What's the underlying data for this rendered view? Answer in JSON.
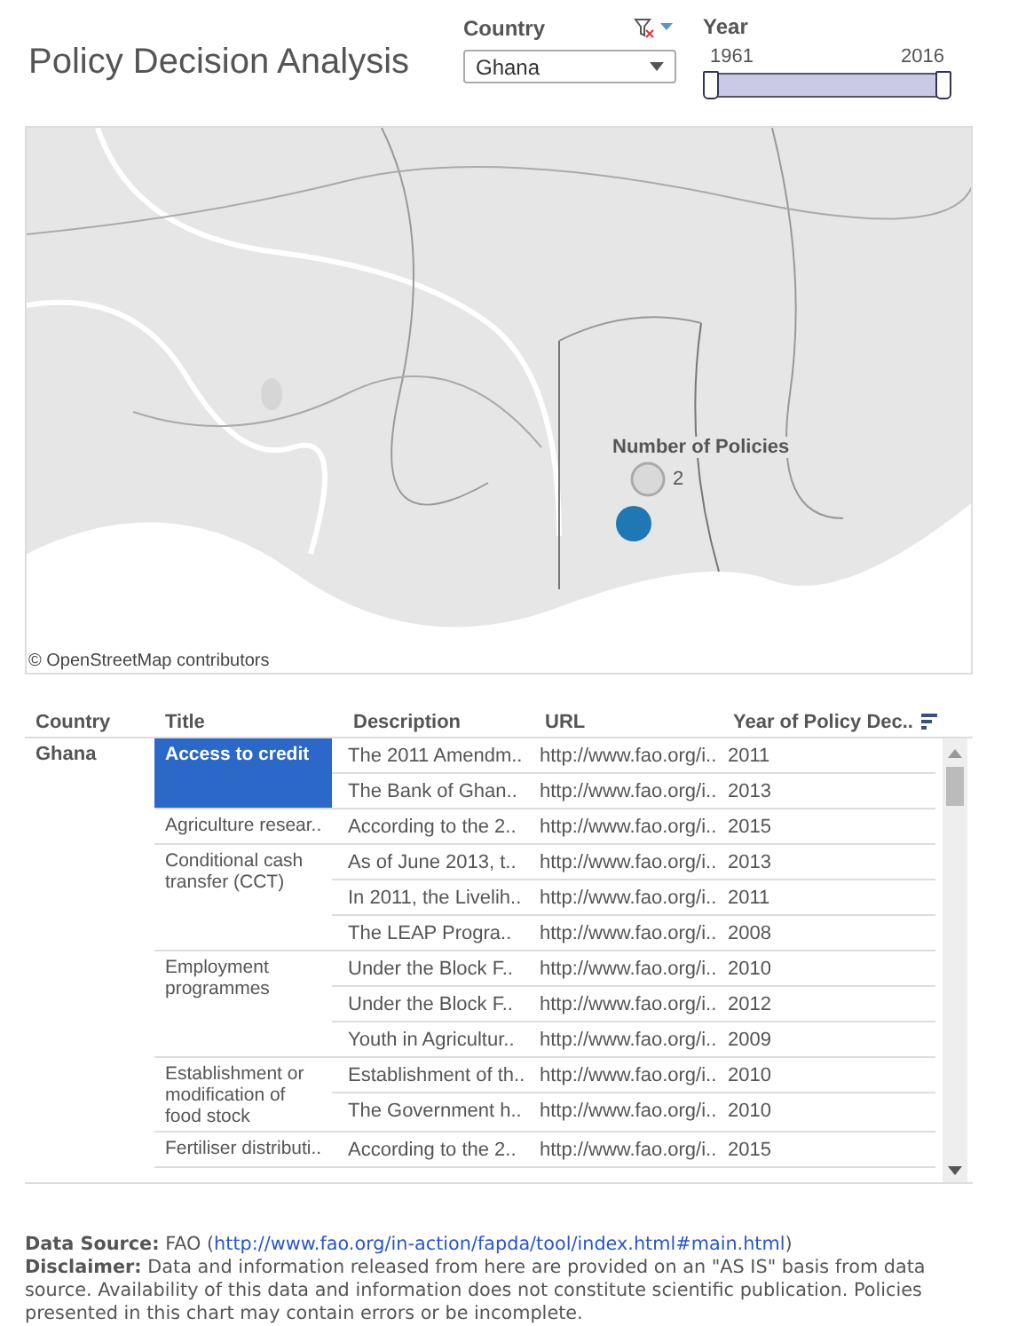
{
  "title": "Policy Decision Analysis",
  "country_filter": {
    "label": "Country",
    "value": "Ghana"
  },
  "year_filter": {
    "label": "Year",
    "start": "1961",
    "end": "2016",
    "level": 1
  },
  "map": {
    "legend_title": "Number of Policies",
    "legend_value": "2",
    "attribution": "© OpenStreetMap contributors"
  },
  "table": {
    "columns": [
      "Country",
      "Title",
      "Description",
      "URL",
      "Year of Policy Dec.."
    ],
    "country": "Ghana",
    "groups": [
      {
        "title": "Access to credit",
        "selected": true,
        "rows": [
          {
            "description": "The 2011 Amendm..",
            "url": "http://www.fao.org/i..",
            "year": "2011"
          },
          {
            "description": "The Bank of Ghan..",
            "url": "http://www.fao.org/i..",
            "year": "2013"
          }
        ]
      },
      {
        "title": "Agriculture resear..",
        "selected": false,
        "rows": [
          {
            "description": "According to the 2..",
            "url": "http://www.fao.org/i..",
            "year": "2015"
          }
        ]
      },
      {
        "title": "Conditional cash transfer (CCT)",
        "selected": false,
        "rows": [
          {
            "description": "As of June 2013, t..",
            "url": "http://www.fao.org/i..",
            "year": "2013"
          },
          {
            "description": "In 2011, the Livelih..",
            "url": "http://www.fao.org/i..",
            "year": "2011"
          },
          {
            "description": "The LEAP Progra..",
            "url": "http://www.fao.org/i..",
            "year": "2008"
          }
        ]
      },
      {
        "title": "Employment programmes",
        "selected": false,
        "rows": [
          {
            "description": "Under the Block F..",
            "url": "http://www.fao.org/i..",
            "year": "2010"
          },
          {
            "description": "Under the Block F..",
            "url": "http://www.fao.org/i..",
            "year": "2012"
          },
          {
            "description": "Youth in Agricultur..",
            "url": "http://www.fao.org/i..",
            "year": "2009"
          }
        ]
      },
      {
        "title": "Establishment or modification of food stock",
        "selected": false,
        "rows": [
          {
            "description": "Establishment of th..",
            "url": "http://www.fao.org/i..",
            "year": "2010"
          },
          {
            "description": "The Government h..",
            "url": "http://www.fao.org/i..",
            "year": "2010"
          }
        ]
      },
      {
        "title": "Fertiliser distributi..",
        "selected": false,
        "rows": [
          {
            "description": "According to the 2..",
            "url": "http://www.fao.org/i..",
            "year": "2015"
          }
        ]
      }
    ]
  },
  "footer": {
    "source_label": "Data Source:",
    "source_text": "FAO (",
    "source_link": "http://www.fao.org/in-action/fapda/tool/index.html#main.html",
    "source_close": ")",
    "disclaimer_label": "Disclaimer:",
    "disclaimer_text": "Data and information released from here are provided on an \"AS IS\" basis from data source. Availability of this data and information does not constitute scientific publication. Policies presented in this chart may contain errors or be incomplete."
  }
}
